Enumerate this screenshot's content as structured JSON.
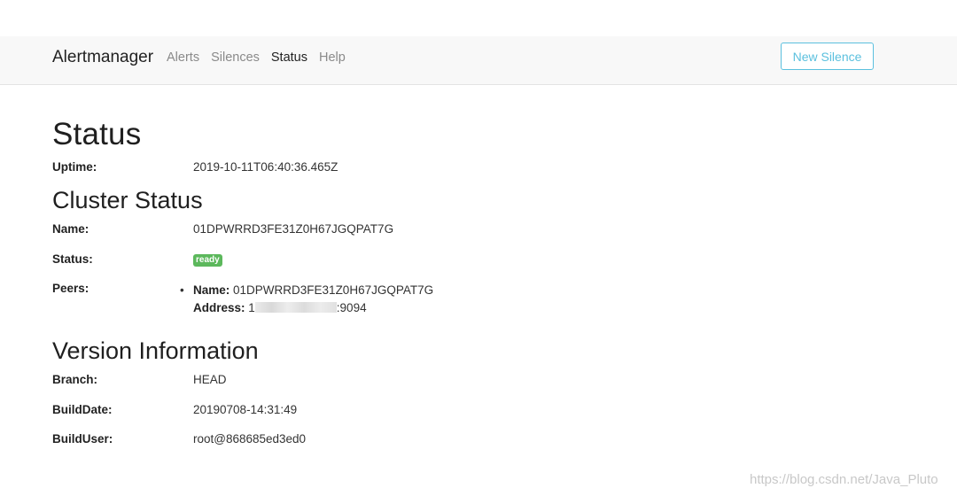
{
  "navbar": {
    "brand": "Alertmanager",
    "links": [
      "Alerts",
      "Silences",
      "Status",
      "Help"
    ],
    "active": "Status",
    "new_silence_label": "New Silence"
  },
  "status": {
    "title": "Status",
    "uptime_label": "Uptime:",
    "uptime_value": "2019-10-11T06:40:36.465Z"
  },
  "cluster": {
    "title": "Cluster Status",
    "name_label": "Name:",
    "name_value": "01DPWRRD3FE31Z0H67JGQPAT7G",
    "status_label": "Status:",
    "status_badge": "ready",
    "peers_label": "Peers:",
    "peer": {
      "name_key": "Name:",
      "name_value": "01DPWRRD3FE31Z0H67JGQPAT7G",
      "address_key": "Address:",
      "address_prefix": "1",
      "address_suffix": ":9094"
    }
  },
  "version": {
    "title": "Version Information",
    "branch_label": "Branch:",
    "branch_value": "HEAD",
    "builddate_label": "BuildDate:",
    "builddate_value": "20190708-14:31:49",
    "builduser_label": "BuildUser:",
    "builduser_value": "root@868685ed3ed0"
  },
  "watermark": "https://blog.csdn.net/Java_Pluto",
  "colors": {
    "navbar_bg": "#f8f8f8",
    "info": "#5bc0de",
    "success": "#5cb85c"
  }
}
